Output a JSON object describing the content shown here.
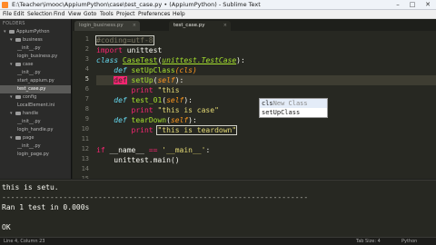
{
  "window": {
    "title": "E:\\Teacher\\imooc\\AppiumPython\\case\\test_case.py • (AppiumPython) - Sublime Text",
    "min_glyph": "–",
    "max_glyph": "□",
    "close_glyph": "✕"
  },
  "menu": [
    "File",
    "Edit",
    "Selection",
    "Find",
    "View",
    "Goto",
    "Tools",
    "Project",
    "Preferences",
    "Help"
  ],
  "sidebar": {
    "header": "FOLDERS",
    "items": [
      {
        "label": "AppiumPython",
        "arrow": "▾",
        "type": "folder",
        "level": 0,
        "selected": false
      },
      {
        "label": "business",
        "arrow": "▾",
        "type": "folder",
        "level": 1,
        "selected": false
      },
      {
        "label": "__init__.py",
        "arrow": "",
        "type": "file",
        "level": 2,
        "selected": false
      },
      {
        "label": "login_business.py",
        "arrow": "",
        "type": "file",
        "level": 2,
        "selected": false
      },
      {
        "label": "case",
        "arrow": "▾",
        "type": "folder",
        "level": 1,
        "selected": false
      },
      {
        "label": "__init__.py",
        "arrow": "",
        "type": "file",
        "level": 2,
        "selected": false
      },
      {
        "label": "start_appium.py",
        "arrow": "",
        "type": "file",
        "level": 2,
        "selected": false
      },
      {
        "label": "test_case.py",
        "arrow": "",
        "type": "file",
        "level": 2,
        "selected": true
      },
      {
        "label": "config",
        "arrow": "▾",
        "type": "folder",
        "level": 1,
        "selected": false
      },
      {
        "label": "LocalElement.ini",
        "arrow": "",
        "type": "file",
        "level": 2,
        "selected": false
      },
      {
        "label": "handle",
        "arrow": "▾",
        "type": "folder",
        "level": 1,
        "selected": false
      },
      {
        "label": "__init__.py",
        "arrow": "",
        "type": "file",
        "level": 2,
        "selected": false
      },
      {
        "label": "login_handle.py",
        "arrow": "",
        "type": "file",
        "level": 2,
        "selected": false
      },
      {
        "label": "page",
        "arrow": "▾",
        "type": "folder",
        "level": 1,
        "selected": false
      },
      {
        "label": "__init__.py",
        "arrow": "",
        "type": "file",
        "level": 2,
        "selected": false
      },
      {
        "label": "login_page.py",
        "arrow": "",
        "type": "file",
        "level": 2,
        "selected": false
      }
    ]
  },
  "tabs": [
    {
      "label": "login_business.py",
      "active": false,
      "close": "×"
    },
    {
      "label": "test_case.py",
      "active": true,
      "close": "×"
    }
  ],
  "editor": {
    "line_numbers": [
      "1",
      "2",
      "3",
      "4",
      "5",
      "6",
      "7",
      "8",
      "9",
      "10",
      "11",
      "12",
      "13",
      "14",
      "15"
    ],
    "current_line": 5,
    "code": {
      "l1": "#coding=utf-8",
      "l2_kw": "import",
      "l2_mod": " unittest",
      "l3_kw": "class",
      "l3_name": "CaseTest",
      "l3_open": "(",
      "l3_base": "unittest.TestCase",
      "l3_close": "):",
      "l4_kw": "def",
      "l4_name": "setUpClass",
      "l4_args": "(cls)",
      "l5_kw": "def",
      "l5_name": "setUp",
      "l5_open": "(",
      "l5_arg": "self",
      "l5_close": "):",
      "l6_kw": "print",
      "l6_str": "\"this",
      "l7_kw": "def",
      "l7_name": "test_01",
      "l7_open": "(",
      "l7_arg": "self",
      "l7_close": "):",
      "l8_kw": "print",
      "l8_str": "\"this is case\"",
      "l9_kw": "def",
      "l9_name": "tearDown",
      "l9_open": "(",
      "l9_arg": "self",
      "l9_close": "):",
      "l10_kw": "print",
      "l10_str": "\"this is teardown\"",
      "l12_kw": "if",
      "l12_a": " __name__ ",
      "l12_op": "==",
      "l12_str": " '__main__'",
      "l12_end": ":",
      "l13": "    unittest.main()"
    },
    "autocomplete": [
      {
        "match": "cls",
        "rest": "New Class",
        "selected": true
      },
      {
        "match": "setUpCl",
        "rest": "ass",
        "selected": false
      }
    ]
  },
  "console": {
    "lines": [
      "this is setu.",
      "----------------------------------------------------------------------",
      "Ran 1 test in 0.000s",
      "",
      "OK"
    ]
  },
  "statusbar": {
    "position": "Line 4, Column 23",
    "tab_size": "Tab Size: 4",
    "syntax": "Python"
  }
}
